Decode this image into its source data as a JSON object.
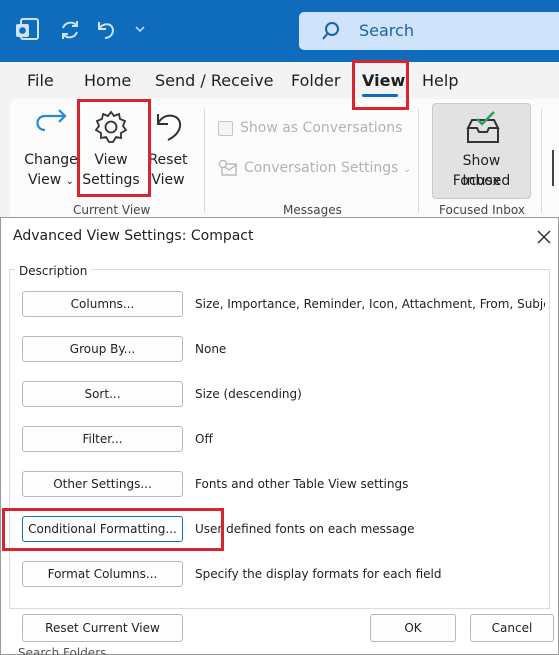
{
  "search": {
    "placeholder": "Search"
  },
  "menu": {
    "tabs": [
      {
        "label": "File"
      },
      {
        "label": "Home"
      },
      {
        "label": "Send / Receive"
      },
      {
        "label": "Folder"
      },
      {
        "label": "View",
        "active": true
      },
      {
        "label": "Help"
      }
    ]
  },
  "ribbon": {
    "change_view": {
      "line1": "Change",
      "line2": "View"
    },
    "view_settings": {
      "line1": "View",
      "line2": "Settings"
    },
    "reset_view": {
      "line1": "Reset",
      "line2": "View"
    },
    "current_view_group": "Current View",
    "show_as_conversations": "Show as Conversations",
    "conversation_settings": "Conversation Settings",
    "messages_group": "Messages",
    "show_focused_inbox": {
      "line1": "Show Focused",
      "line2": "Inbox"
    },
    "focused_inbox_group": "Focused Inbox"
  },
  "dialog": {
    "title": "Advanced View Settings: Compact",
    "description_label": "Description",
    "rows": [
      {
        "button": "Columns...",
        "value": "Size, Importance, Reminder, Icon, Attachment, From, Subje..."
      },
      {
        "button": "Group By...",
        "value": "None"
      },
      {
        "button": "Sort...",
        "value": "Size (descending)"
      },
      {
        "button": "Filter...",
        "value": "Off"
      },
      {
        "button": "Other Settings...",
        "value": "Fonts and other Table View settings"
      },
      {
        "button": "Conditional Formatting...",
        "value": "User defined fonts on each message"
      },
      {
        "button": "Format Columns...",
        "value": "Specify the display formats for each field"
      }
    ],
    "reset_button": "Reset Current View",
    "ok_button": "OK",
    "cancel_button": "Cancel"
  },
  "behind": {
    "peek_text": "Search Folders"
  },
  "colors": {
    "accent": "#0f6cbd",
    "highlight": "#d9232d",
    "search_bg": "#cfe4fa"
  },
  "icons": [
    "outlook-icon",
    "sync-icon",
    "undo-icon",
    "customize-icon",
    "search-icon",
    "change-view-icon",
    "gear-icon",
    "reset-view-icon",
    "conversation-settings-icon",
    "inbox-check-icon",
    "close-icon"
  ]
}
